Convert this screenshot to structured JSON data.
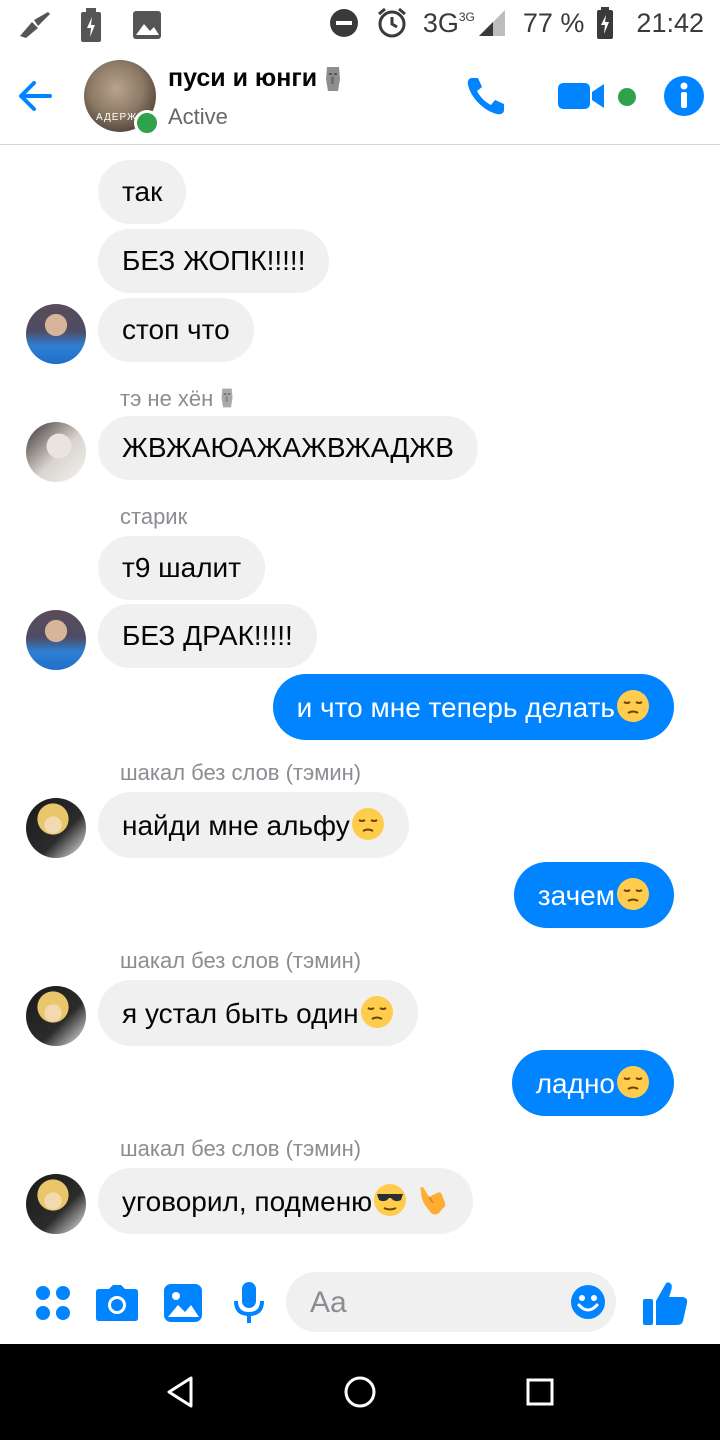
{
  "status_bar": {
    "network": "3G",
    "network_sup": "3G",
    "battery": "77 %",
    "time": "21:42"
  },
  "header": {
    "title": "пуси и юнги",
    "status": "Active",
    "avatar_caption": "АДЕРЖ"
  },
  "messages": [
    {
      "side": "in",
      "text": "так"
    },
    {
      "side": "in",
      "text": "БЕЗ ЖОПК!!!!!"
    },
    {
      "side": "in",
      "text": "стоп что"
    },
    {
      "side": "in",
      "sender": "тэ не хён",
      "text": "ЖВЖАЮАЖАЖВЖАДЖВ"
    },
    {
      "side": "in",
      "sender": "старик",
      "text": "т9 шалит"
    },
    {
      "side": "in",
      "text": "БЕЗ ДРАК!!!!!"
    },
    {
      "side": "out",
      "text": "и что мне теперь делать"
    },
    {
      "side": "in",
      "sender": "шакал без слов (тэмин)",
      "text": "найди мне альфу"
    },
    {
      "side": "out",
      "text": "зачем"
    },
    {
      "side": "in",
      "sender": "шакал без слов (тэмин)",
      "text": "я устал быть один"
    },
    {
      "side": "out",
      "text": "ладно"
    },
    {
      "side": "in",
      "sender": "шакал без слов (тэмин)",
      "text": "уговорил, подменю"
    }
  ],
  "composer": {
    "placeholder": "Aa"
  },
  "colors": {
    "accent": "#0084ff",
    "incoming_bubble": "#f0f0f0",
    "online": "#31a24c"
  },
  "icons": [
    "menu-dots-icon",
    "camera-icon",
    "image-icon",
    "microphone-icon",
    "emoji-icon",
    "like-icon"
  ]
}
